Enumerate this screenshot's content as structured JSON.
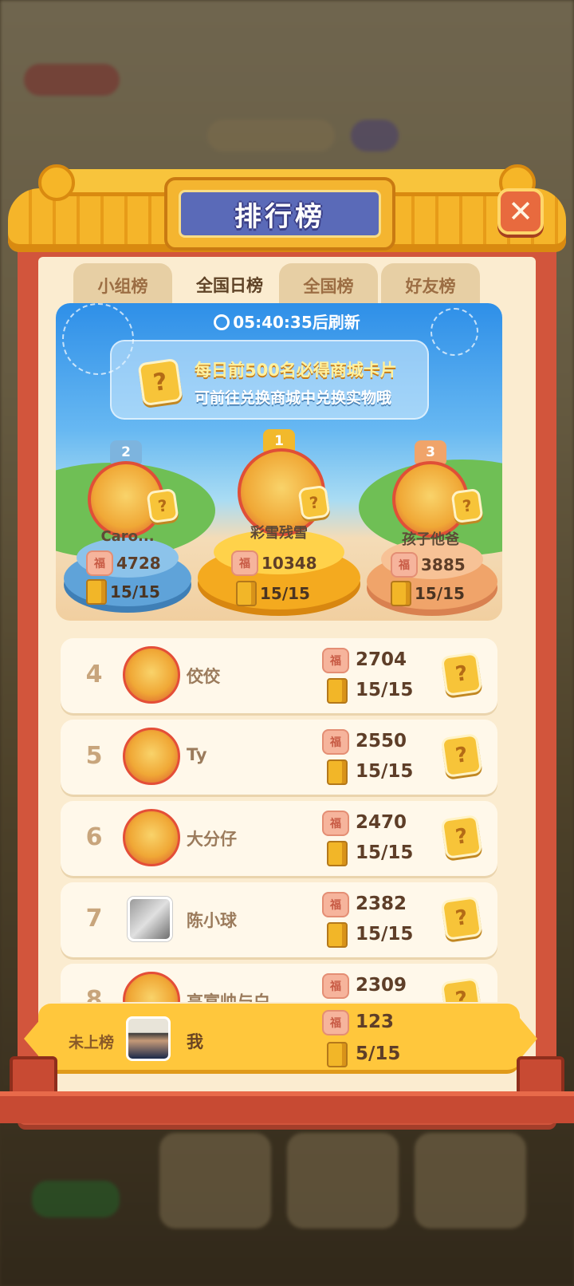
{
  "title": "排行榜",
  "tabs": [
    {
      "label": "小组榜",
      "active": false
    },
    {
      "label": "全国日榜",
      "active": true
    },
    {
      "label": "全国榜",
      "active": false
    },
    {
      "label": "好友榜",
      "active": false
    }
  ],
  "banner": {
    "refresh_text": "05:40:35后刷新",
    "notice_line1": "每日前500名必得商城卡片",
    "notice_line2": "可前往兑换商城中兑换实物哦"
  },
  "podium": {
    "first": {
      "rank": "1",
      "name": "彩雪残雪",
      "score": "10348",
      "progress": "15/15"
    },
    "second": {
      "rank": "2",
      "name": "Caro...",
      "score": "4728",
      "progress": "15/15"
    },
    "third": {
      "rank": "3",
      "name": "孩子他爸",
      "score": "3885",
      "progress": "15/15"
    }
  },
  "icons": {
    "fu": "福",
    "card": "?"
  },
  "list": [
    {
      "rank": "4",
      "name": "佼佼",
      "score": "2704",
      "progress": "15/15",
      "avatar": "badge"
    },
    {
      "rank": "5",
      "name": "Ty",
      "score": "2550",
      "progress": "15/15",
      "avatar": "badge"
    },
    {
      "rank": "6",
      "name": "大分仔",
      "score": "2470",
      "progress": "15/15",
      "avatar": "badge"
    },
    {
      "rank": "7",
      "name": "陈小球",
      "score": "2382",
      "progress": "15/15",
      "avatar": "photo"
    },
    {
      "rank": "8",
      "name": "高富帅与白",
      "score": "2309",
      "progress": "",
      "avatar": "badge"
    }
  ],
  "me": {
    "rank_label": "未上榜",
    "name": "我",
    "score": "123",
    "progress": "5/15"
  },
  "colors": {
    "frame": "#d2553c",
    "roof": "#f5b52a",
    "plaque": "#5a6ab8",
    "panel": "#fbecd0",
    "me_bar": "#ffc73c"
  }
}
